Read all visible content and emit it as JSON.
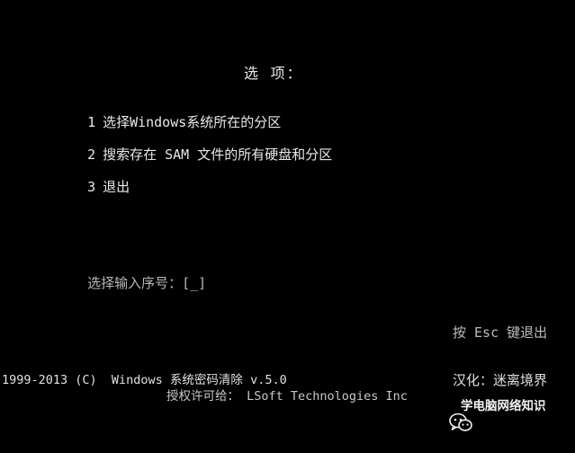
{
  "menu": {
    "title": "选 项：",
    "options": [
      {
        "num": "1",
        "label": "选择Windows系统所在的分区"
      },
      {
        "num": "2",
        "label": "搜索存在 SAM 文件的所有硬盘和分区"
      },
      {
        "num": "3",
        "label": "退出"
      }
    ]
  },
  "prompt": {
    "label": "选择输入序号：",
    "input_value": "[_]"
  },
  "esc_hint": "按 Esc 键退出",
  "footer": {
    "copyright": "1999-2013 (C)  Windows 系统密码清除 v.5.0",
    "license": "授权许可给： LSoft Technologies Inc",
    "translator": "汉化：迷离境界",
    "watermark": "学电脑网络知识"
  },
  "icons": {
    "watermark_icon": "wechat-icon"
  },
  "colors": {
    "background": "#000000",
    "text": "#c8c8c8"
  }
}
